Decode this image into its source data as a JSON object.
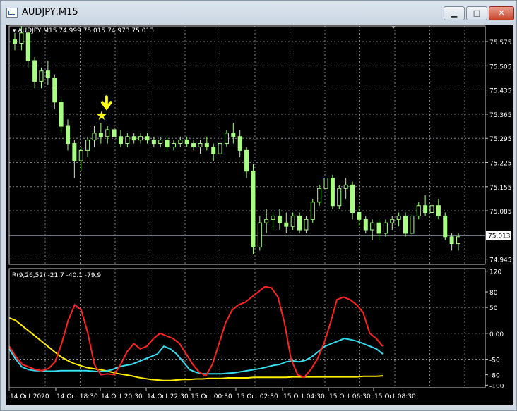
{
  "window": {
    "title": "AUDJPY,M15",
    "minimize_glyph": "▁",
    "maximize_glyph": "□",
    "close_glyph": "✕"
  },
  "price_panel": {
    "header": "AUDJPY,M15  74.999 75.015 74.973 75.013",
    "price_labels": [
      "75.575",
      "75.505",
      "75.435",
      "75.365",
      "75.295",
      "75.225",
      "75.155",
      "75.085",
      "75.013",
      "74.945"
    ],
    "current_price": "75.013",
    "marker_icons": [
      "down-arrow-icon",
      "star-icon"
    ],
    "marker_color": "#ffff00",
    "candle_color": "#a8ff82"
  },
  "indicator_panel": {
    "header": "R(9,26,52) -21.7 -40.1 -79.9",
    "scale_labels": [
      "120",
      "80",
      "50",
      "0.00",
      "-50",
      "-80",
      "-100"
    ],
    "line_colors": [
      "#ff2222",
      "#33ddee",
      "#ffee00"
    ]
  },
  "time_labels": [
    "14 Oct 2020",
    "14 Oct 18:30",
    "14 Oct 20:30",
    "14 Oct 22:30",
    "15 Oct 00:30",
    "15 Oct 02:30",
    "15 Oct 04:30",
    "15 Oct 06:30",
    "15 Oct 08:30"
  ],
  "chart_data": {
    "type": "candlestick",
    "symbol": "AUDJPY",
    "timeframe": "M15",
    "ohlc_last": {
      "open": 74.999,
      "high": 75.015,
      "low": 74.973,
      "close": 75.013
    },
    "price_range": [
      74.93,
      75.62
    ],
    "candles": [
      [
        75.58,
        75.6,
        75.55,
        75.57
      ],
      [
        75.57,
        75.62,
        75.55,
        75.6
      ],
      [
        75.6,
        75.61,
        75.5,
        75.52
      ],
      [
        75.52,
        75.53,
        75.44,
        75.46
      ],
      [
        75.46,
        75.5,
        75.44,
        75.49
      ],
      [
        75.49,
        75.52,
        75.45,
        75.47
      ],
      [
        75.47,
        75.48,
        75.38,
        75.4
      ],
      [
        75.4,
        75.41,
        75.31,
        75.33
      ],
      [
        75.33,
        75.35,
        75.26,
        75.28
      ],
      [
        75.28,
        75.29,
        75.18,
        75.23
      ],
      [
        75.23,
        75.27,
        75.2,
        75.26
      ],
      [
        75.26,
        75.3,
        75.24,
        75.29
      ],
      [
        75.29,
        75.33,
        75.27,
        75.31
      ],
      [
        75.31,
        75.34,
        75.28,
        75.3
      ],
      [
        75.3,
        75.33,
        75.28,
        75.32
      ],
      [
        75.32,
        75.33,
        75.29,
        75.3
      ],
      [
        75.3,
        75.32,
        75.27,
        75.28
      ],
      [
        75.28,
        75.31,
        75.27,
        75.3
      ],
      [
        75.3,
        75.31,
        75.28,
        75.29
      ],
      [
        75.29,
        75.31,
        75.28,
        75.3
      ],
      [
        75.3,
        75.31,
        75.28,
        75.29
      ],
      [
        75.29,
        75.3,
        75.27,
        75.28
      ],
      [
        75.28,
        75.3,
        75.27,
        75.29
      ],
      [
        75.29,
        75.3,
        75.26,
        75.27
      ],
      [
        75.27,
        75.29,
        75.26,
        75.28
      ],
      [
        75.28,
        75.3,
        75.27,
        75.29
      ],
      [
        75.29,
        75.3,
        75.27,
        75.28
      ],
      [
        75.28,
        75.29,
        75.26,
        75.27
      ],
      [
        75.27,
        75.29,
        75.25,
        75.28
      ],
      [
        75.28,
        75.3,
        75.26,
        75.27
      ],
      [
        75.27,
        75.28,
        75.23,
        75.25
      ],
      [
        75.25,
        75.29,
        75.24,
        75.28
      ],
      [
        75.28,
        75.32,
        75.27,
        75.31
      ],
      [
        75.31,
        75.34,
        75.28,
        75.3
      ],
      [
        75.3,
        75.32,
        75.24,
        75.26
      ],
      [
        75.26,
        75.27,
        75.18,
        75.2
      ],
      [
        75.2,
        75.22,
        74.96,
        74.98
      ],
      [
        74.98,
        75.07,
        74.97,
        75.05
      ],
      [
        75.05,
        75.09,
        75.02,
        75.06
      ],
      [
        75.06,
        75.08,
        75.03,
        75.07
      ],
      [
        75.07,
        75.09,
        75.03,
        75.05
      ],
      [
        75.05,
        75.08,
        75.02,
        75.04
      ],
      [
        75.04,
        75.08,
        75.03,
        75.07
      ],
      [
        75.07,
        75.08,
        75.02,
        75.03
      ],
      [
        75.03,
        75.07,
        75.02,
        75.06
      ],
      [
        75.06,
        75.12,
        75.05,
        75.11
      ],
      [
        75.11,
        75.16,
        75.1,
        75.15
      ],
      [
        75.15,
        75.2,
        75.13,
        75.18
      ],
      [
        75.18,
        75.19,
        75.09,
        75.1
      ],
      [
        75.1,
        75.16,
        75.09,
        75.15
      ],
      [
        75.15,
        75.18,
        75.12,
        75.16
      ],
      [
        75.16,
        75.17,
        75.06,
        75.08
      ],
      [
        75.08,
        75.1,
        75.04,
        75.06
      ],
      [
        75.06,
        75.07,
        75.02,
        75.03
      ],
      [
        75.03,
        75.06,
        75.0,
        75.05
      ],
      [
        75.05,
        75.06,
        75.0,
        75.02
      ],
      [
        75.02,
        75.06,
        75.01,
        75.05
      ],
      [
        75.05,
        75.07,
        75.03,
        75.06
      ],
      [
        75.06,
        75.08,
        75.04,
        75.07
      ],
      [
        75.07,
        75.08,
        75.01,
        75.02
      ],
      [
        75.02,
        75.08,
        75.01,
        75.07
      ],
      [
        75.07,
        75.11,
        75.06,
        75.1
      ],
      [
        75.1,
        75.13,
        75.07,
        75.08
      ],
      [
        75.08,
        75.11,
        75.06,
        75.1
      ],
      [
        75.1,
        75.12,
        75.06,
        75.07
      ],
      [
        75.07,
        75.08,
        75.0,
        75.01
      ],
      [
        75.01,
        75.02,
        74.97,
        74.99
      ],
      [
        74.99,
        75.02,
        74.97,
        75.01
      ]
    ],
    "indicator": {
      "name": "R(9,26,52)",
      "values": [
        -21.7,
        -40.1,
        -79.9
      ],
      "range": [
        -105,
        125
      ],
      "red": [
        -25,
        -45,
        -60,
        -65,
        -70,
        -72,
        -68,
        -55,
        -20,
        25,
        55,
        45,
        0,
        -60,
        -80,
        -78,
        -80,
        -60,
        -35,
        -20,
        -30,
        -25,
        -10,
        0,
        -5,
        -10,
        -20,
        -40,
        -60,
        -75,
        -82,
        -60,
        -20,
        20,
        45,
        55,
        60,
        70,
        80,
        90,
        88,
        70,
        20,
        -50,
        -80,
        -85,
        -70,
        -50,
        -20,
        20,
        65,
        70,
        65,
        55,
        40,
        0,
        -10,
        -25
      ],
      "cyan": [
        -30,
        -50,
        -65,
        -70,
        -72,
        -72,
        -73,
        -73,
        -72,
        -72,
        -72,
        -72,
        -72,
        -73,
        -74,
        -73,
        -70,
        -65,
        -62,
        -60,
        -55,
        -50,
        -45,
        -40,
        -25,
        -30,
        -40,
        -55,
        -70,
        -75,
        -78,
        -78,
        -78,
        -78,
        -77,
        -76,
        -74,
        -72,
        -70,
        -68,
        -65,
        -62,
        -60,
        -55,
        -53,
        -55,
        -52,
        -45,
        -35,
        -25,
        -20,
        -15,
        -10,
        -12,
        -15,
        -20,
        -25,
        -30,
        -40
      ],
      "yellow": [
        30,
        25,
        15,
        5,
        -5,
        -15,
        -25,
        -35,
        -45,
        -52,
        -58,
        -62,
        -66,
        -68,
        -70,
        -72,
        -75,
        -78,
        -80,
        -82,
        -85,
        -87,
        -89,
        -90,
        -91,
        -91,
        -90,
        -89,
        -89,
        -88,
        -88,
        -87,
        -87,
        -87,
        -86,
        -86,
        -86,
        -86,
        -85,
        -85,
        -85,
        -85,
        -85,
        -85,
        -84,
        -84,
        -84,
        -84,
        -84,
        -84,
        -84,
        -84,
        -84,
        -84,
        -84,
        -83,
        -83,
        -83,
        -82
      ]
    }
  }
}
